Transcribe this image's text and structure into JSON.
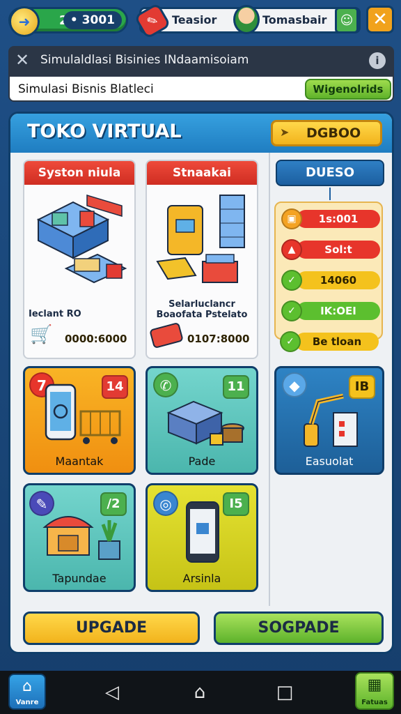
{
  "hud": {
    "level": "29",
    "coins": "• 3001",
    "player_title": "Teasior",
    "player_name": "Tomasbair"
  },
  "browser": {
    "title": "Simulaldlasi Bisinies INdaamisoiam",
    "url_value": "Simulasi Bisnis Blatleci",
    "go_label": "Wigenolrids"
  },
  "panel": {
    "title": "TOKO VIRTUAL",
    "header_button": "DGBOO",
    "cards": [
      {
        "head": "Syston niula",
        "caption": "Ieclant  RO",
        "price": "0000:6000"
      },
      {
        "head": "Stnaakai",
        "caption": "Selarluclancr\nBoaofata Pstelato",
        "price": "0107:8000"
      }
    ],
    "tiles": [
      {
        "label": "Maantak",
        "badge": "14",
        "icon": "7"
      },
      {
        "label": "Pade",
        "badge": "11",
        "icon": "✆"
      },
      {
        "label": "Easuolat",
        "badge": "IB",
        "icon": "◆"
      },
      {
        "label": "Tapundae",
        "badge": "/2",
        "icon": "✎"
      },
      {
        "label": "Arsinla",
        "badge": "I5",
        "icon": "◎"
      }
    ],
    "side_tab": "DUESO",
    "side_items": [
      {
        "label": "1s:001",
        "color": "#e7352b"
      },
      {
        "label": "Sol:t",
        "color": "#e7352b"
      },
      {
        "label": "14060",
        "color": "#f4c21d"
      },
      {
        "label": "IK:OEI",
        "color": "#5cbf2f"
      },
      {
        "label": "Be tloan",
        "color": "#f4c21d"
      }
    ],
    "buttons": {
      "upgrade": "UPGADE",
      "secondary": "SOGPADE"
    }
  },
  "nav": {
    "home_label": "Vanre",
    "shop_label": "Fatuas"
  },
  "colors": {
    "accent_blue": "#1f7dc1",
    "accent_green": "#5fb22a",
    "accent_orange": "#f2b31c",
    "accent_red": "#cf2d22"
  }
}
